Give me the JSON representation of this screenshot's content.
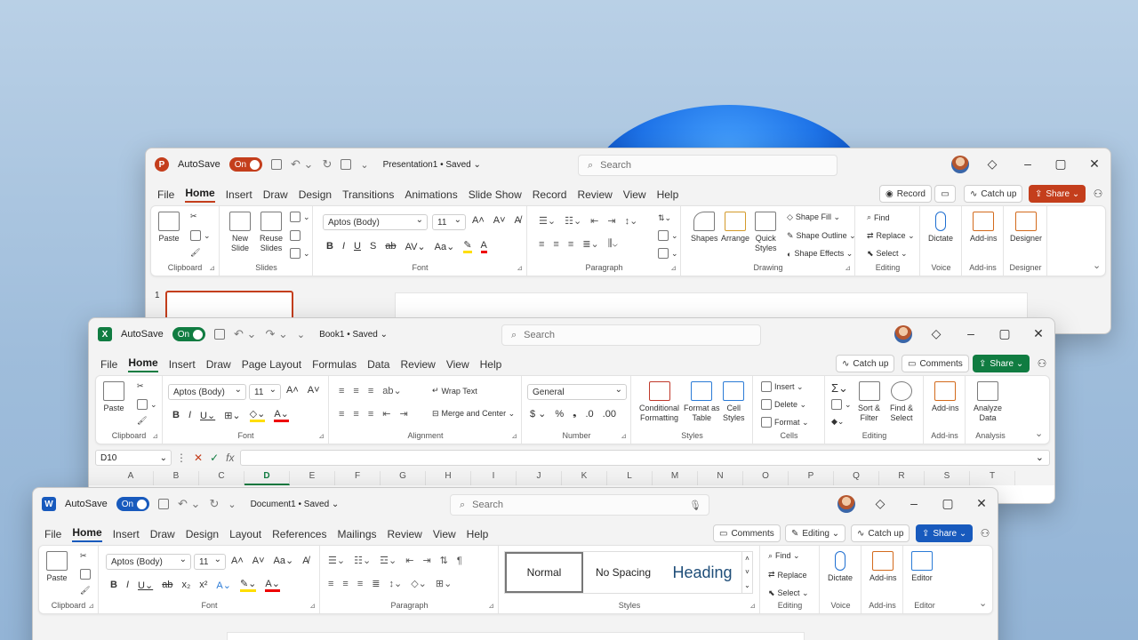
{
  "colors": {
    "ppt": "#c43e1c",
    "excel": "#107c41",
    "word": "#185abd",
    "share_ppt": "#c43e1c",
    "share_excel": "#107c41",
    "share_word": "#185abd"
  },
  "ppt": {
    "logo": "P",
    "autosave": "AutoSave",
    "toggle": "On",
    "doc": "Presentation1 • Saved ⌄",
    "search": "Search",
    "tabs": [
      "File",
      "Home",
      "Insert",
      "Draw",
      "Design",
      "Transitions",
      "Animations",
      "Slide Show",
      "Record",
      "Review",
      "View",
      "Help"
    ],
    "record": "Record",
    "catch_up": "Catch up",
    "share": "Share ⌄",
    "clipboard": {
      "paste": "Paste",
      "label": "Clipboard"
    },
    "slides": {
      "new": "New\nSlide",
      "reuse": "Reuse\nSlides",
      "label": "Slides"
    },
    "font": {
      "name": "Aptos (Body)",
      "size": "11",
      "label": "Font"
    },
    "paragraph": {
      "label": "Paragraph"
    },
    "drawing": {
      "shapes": "Shapes",
      "arrange": "Arrange",
      "quick": "Quick\nStyles",
      "fill": "Shape Fill ⌄",
      "outline": "Shape Outline ⌄",
      "effects": "Shape Effects ⌄",
      "label": "Drawing"
    },
    "editing": {
      "find": "Find",
      "replace": "Replace ⌄",
      "select": "Select ⌄",
      "label": "Editing"
    },
    "voice": {
      "dictate": "Dictate",
      "label": "Voice"
    },
    "addins": {
      "btn": "Add-ins",
      "label": "Add-ins"
    },
    "designer": {
      "btn": "Designer",
      "label": "Designer"
    },
    "slide_number": "1"
  },
  "excel": {
    "logo": "X",
    "autosave": "AutoSave",
    "toggle": "On",
    "doc": "Book1 • Saved ⌄",
    "search": "Search",
    "tabs": [
      "File",
      "Home",
      "Insert",
      "Draw",
      "Page Layout",
      "Formulas",
      "Data",
      "Review",
      "View",
      "Help"
    ],
    "catch_up": "Catch up",
    "comments": "Comments",
    "share": "Share ⌄",
    "clipboard": {
      "paste": "Paste",
      "label": "Clipboard"
    },
    "font": {
      "name": "Aptos (Body)",
      "size": "11",
      "label": "Font"
    },
    "alignment": {
      "wrap": "Wrap Text",
      "merge": "Merge and Center ⌄",
      "label": "Alignment"
    },
    "number": {
      "format": "General",
      "label": "Number"
    },
    "styles": {
      "cond": "Conditional\nFormatting",
      "table": "Format as\nTable",
      "cell": "Cell\nStyles",
      "label": "Styles"
    },
    "cells": {
      "insert": "Insert ⌄",
      "delete": "Delete ⌄",
      "format": "Format ⌄",
      "label": "Cells"
    },
    "editing": {
      "sort": "Sort &\nFilter",
      "find": "Find &\nSelect",
      "label": "Editing"
    },
    "addins": {
      "btn": "Add-ins",
      "label": "Add-ins"
    },
    "analysis": {
      "btn": "Analyze\nData",
      "label": "Analysis"
    },
    "namebox": "D10",
    "fx": "fx",
    "columns": [
      "A",
      "B",
      "C",
      "D",
      "E",
      "F",
      "G",
      "H",
      "I",
      "J",
      "K",
      "L",
      "M",
      "N",
      "O",
      "P",
      "Q",
      "R",
      "S",
      "T"
    ]
  },
  "word": {
    "logo": "W",
    "autosave": "AutoSave",
    "toggle": "On",
    "doc": "Document1 • Saved ⌄",
    "search": "Search",
    "tabs": [
      "File",
      "Home",
      "Insert",
      "Draw",
      "Design",
      "Layout",
      "References",
      "Mailings",
      "Review",
      "View",
      "Help"
    ],
    "comments": "Comments",
    "editing_mode": "Editing ⌄",
    "catch_up": "Catch up",
    "share": "Share ⌄",
    "clipboard": {
      "paste": "Paste",
      "label": "Clipboard"
    },
    "font": {
      "name": "Aptos (Body)",
      "size": "11",
      "label": "Font"
    },
    "paragraph": {
      "label": "Paragraph"
    },
    "styles": {
      "normal": "Normal",
      "nospacing": "No Spacing",
      "heading": "Heading",
      "label": "Styles"
    },
    "editing": {
      "find": "Find ⌄",
      "replace": "Replace",
      "select": "Select ⌄",
      "label": "Editing"
    },
    "voice": {
      "dictate": "Dictate",
      "label": "Voice"
    },
    "addins": {
      "btn": "Add-ins",
      "label": "Add-ins"
    },
    "editor": {
      "btn": "Editor",
      "label": "Editor"
    }
  }
}
